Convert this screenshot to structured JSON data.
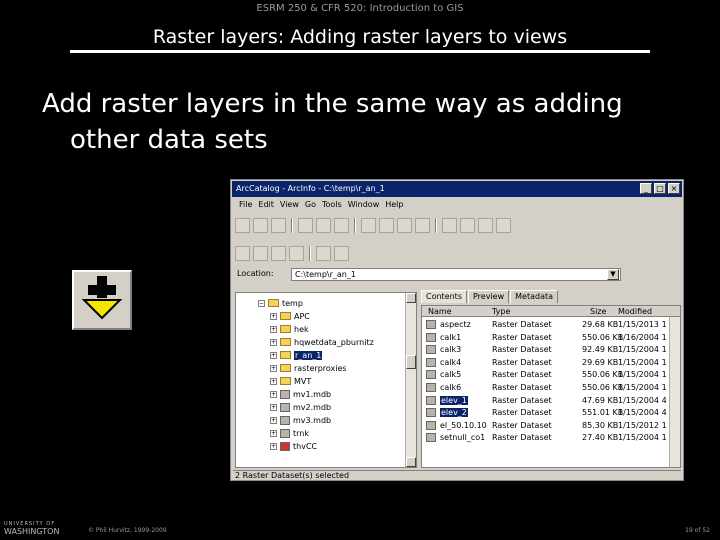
{
  "slide": {
    "course": "ESRM 250 & CFR 520: Introduction to GIS",
    "title": "Raster layers: Adding raster layers to views",
    "bullet": "Add raster layers in the same way as adding other data sets",
    "university_top": "UNIVERSITY OF",
    "university_name": "WASHINGTON",
    "copyright": "© Phil Hurvitz, 1999-2009",
    "page": "19 of 52"
  },
  "app": {
    "window_title": "ArcCatalog - ArcInfo - C:\\temp\\r_an_1",
    "menu": [
      "File",
      "Edit",
      "View",
      "Go",
      "Tools",
      "Window",
      "Help"
    ],
    "location_label": "Location:",
    "location_value": "C:\\temp\\r_an_1",
    "tree": {
      "root": "temp",
      "items": [
        "APC",
        "hek",
        "hqwetdata_pburnitz",
        "r_an_1",
        "rasterproxies",
        "MVT",
        "mv1.mdb",
        "mv2.mdb",
        "mv3.mdb",
        "trnk",
        "thvCC"
      ],
      "selected": "r_an_1"
    },
    "tabs": [
      "Contents",
      "Preview",
      "Metadata"
    ],
    "active_tab": "Contents",
    "columns": [
      "Name",
      "Type",
      "Size",
      "Modified"
    ],
    "rows": [
      [
        "aspectz",
        "Raster Dataset",
        "29.68 KB",
        "1/15/2013 1"
      ],
      [
        "calk1",
        "Raster Dataset",
        "550.06 KB",
        "1/16/2004 1"
      ],
      [
        "calk3",
        "Raster Dataset",
        "92.49 KB",
        "1/15/2004 1"
      ],
      [
        "calk4",
        "Raster Dataset",
        "29.69 KB",
        "1/15/2004 1"
      ],
      [
        "calk5",
        "Raster Dataset",
        "550.06 KB",
        "1/15/2004 1"
      ],
      [
        "calk6",
        "Raster Dataset",
        "550.06 KB",
        "1/15/2004 1"
      ],
      [
        "elev_1",
        "Raster Dataset",
        "47.69 KB",
        "1/15/2004 4"
      ],
      [
        "elev_2",
        "Raster Dataset",
        "551.01 KB",
        "1/15/2004 4"
      ],
      [
        "el_50.10.10",
        "Raster Dataset",
        "85.30 KB",
        "1/15/2012 1"
      ],
      [
        "setnull_co1",
        "Raster Dataset",
        "27.40 KB",
        "1/15/2004 1"
      ]
    ],
    "selected_rows": [
      6,
      7
    ],
    "status": "2 Raster Dataset(s) selected",
    "buttons": {
      "minimize": "_",
      "maximize": "□",
      "close": "×"
    }
  },
  "icons": [
    "add-data-icon",
    "folder-icon",
    "raster-icon"
  ],
  "colors": {
    "background": "#000000",
    "titlebar": "#0a246a",
    "selection": "#0a246a",
    "window_chrome": "#d4d0c8",
    "add_data_arrow": "#f5e400"
  }
}
